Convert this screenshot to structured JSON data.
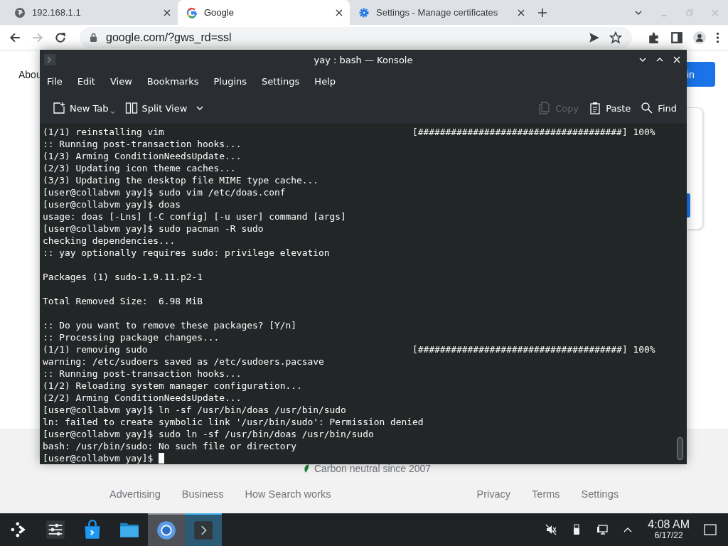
{
  "browser": {
    "tabs": [
      {
        "title": "192.168.1.1",
        "kind": "globe",
        "selected": false
      },
      {
        "title": "Google",
        "kind": "google",
        "selected": true
      },
      {
        "title": "Settings - Manage certificates",
        "kind": "gear",
        "selected": false
      }
    ],
    "url": "google.com/?gws_rd=ssl",
    "page": {
      "about": "Abou",
      "sign_in": "in",
      "carbon": "Carbon neutral since 2007",
      "footer_left": [
        "Advertising",
        "Business",
        "How Search works"
      ],
      "footer_right": [
        "Privacy",
        "Terms",
        "Settings"
      ]
    }
  },
  "konsole": {
    "title": "yay : bash — Konsole",
    "menu": [
      "File",
      "Edit",
      "View",
      "Bookmarks",
      "Plugins",
      "Settings",
      "Help"
    ],
    "toolbar": [
      {
        "label": "New Tab",
        "kind": "new-tab",
        "disabled": false
      },
      {
        "label": "Split View",
        "kind": "split",
        "disabled": false
      },
      {
        "label": "Copy",
        "kind": "copy",
        "disabled": true
      },
      {
        "label": "Paste",
        "kind": "paste",
        "disabled": false
      },
      {
        "label": "Find",
        "kind": "find",
        "disabled": false
      }
    ],
    "lines": [
      {
        "text": "(1/1) reinstalling vim",
        "progress": "[#####################################] 100%"
      },
      {
        "text": ":: Running post-transaction hooks..."
      },
      {
        "text": "(1/3) Arming ConditionNeedsUpdate..."
      },
      {
        "text": "(2/3) Updating icon theme caches..."
      },
      {
        "text": "(3/3) Updating the desktop file MIME type cache..."
      },
      {
        "text": "[user@collabvm yay]$ sudo vim /etc/doas.conf"
      },
      {
        "text": "[user@collabvm yay]$ doas"
      },
      {
        "text": "usage: doas [-Lns] [-C config] [-u user] command [args]"
      },
      {
        "text": "[user@collabvm yay]$ sudo pacman -R sudo"
      },
      {
        "text": "checking dependencies..."
      },
      {
        "text": ":: yay optionally requires sudo: privilege elevation"
      },
      {
        "text": "Packages (1) sudo-1.9.11.p2-1",
        "blank_before": true
      },
      {
        "text": "Total Removed Size:  6.98 MiB",
        "blank_before": true
      },
      {
        "text": ":: Do you want to remove these packages? [Y/n]",
        "blank_before": true
      },
      {
        "text": ":: Processing package changes..."
      },
      {
        "text": "(1/1) removing sudo",
        "progress": "[#####################################] 100%"
      },
      {
        "text": "warning: /etc/sudoers saved as /etc/sudoers.pacsave"
      },
      {
        "text": ":: Running post-transaction hooks..."
      },
      {
        "text": "(1/2) Reloading system manager configuration..."
      },
      {
        "text": "(2/2) Arming ConditionNeedsUpdate..."
      },
      {
        "text": "[user@collabvm yay]$ ln -sf /usr/bin/doas /usr/bin/sudo"
      },
      {
        "text": "ln: failed to create symbolic link '/usr/bin/sudo': Permission denied"
      },
      {
        "text": "[user@collabvm yay]$ sudo ln -sf /usr/bin/doas /usr/bin/sudo"
      },
      {
        "text": "bash: /usr/bin/sudo: No such file or directory"
      },
      {
        "text": "[user@collabvm yay]$",
        "cursor": true
      }
    ]
  },
  "taskbar": {
    "apps": [
      {
        "kind": "launcher",
        "open": false,
        "selected": false
      },
      {
        "kind": "settings",
        "open": false,
        "selected": false
      },
      {
        "kind": "store",
        "open": false,
        "selected": false
      },
      {
        "kind": "files",
        "open": false,
        "selected": false
      },
      {
        "kind": "browser",
        "open": true,
        "selected": false
      },
      {
        "kind": "terminal",
        "open": true,
        "selected": true
      }
    ],
    "time": "4:08 AM",
    "date": "6/17/22"
  }
}
